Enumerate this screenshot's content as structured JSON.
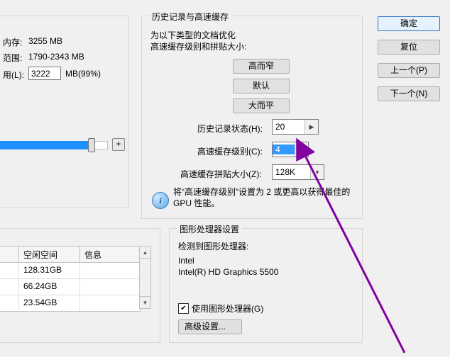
{
  "memory": {
    "label": "内存:",
    "value": "3255 MB",
    "rangeLabel": "范围:",
    "rangeValue": "1790-2343 MB",
    "usedLabel": "用(L):",
    "usedInput": "3222",
    "usedSuffix": "MB(99%)"
  },
  "history": {
    "title": "历史记录与高速缓存",
    "optLabel1": "为以下类型的文档优化",
    "optLabel2": "高速缓存级别和拼贴大小:",
    "btnTall": "高而窄",
    "btnDefault": "默认",
    "btnWide": "大而平",
    "histStatesLabel": "历史记录状态(H):",
    "histStates": "20",
    "cacheLevelLabel": "高速缓存级别(C):",
    "cacheLevel": "4",
    "tileLabel": "高速缓存拼贴大小(Z):",
    "tile": "128K",
    "tip": "将“高速缓存级别”设置为 2 或更高以获得最佳的 GPU 性能。"
  },
  "gpu": {
    "title": "图形处理器设置",
    "detectedLabel": "检测到图形处理器:",
    "vendor": "Intel",
    "model": "Intel(R) HD Graphics 5500",
    "useGpu": "使用图形处理器(G)",
    "advanced": "高级设置..."
  },
  "disks": {
    "colFree": "空闲空间",
    "colInfo": "信息",
    "rows": [
      "128.31GB",
      "66.24GB",
      "23.54GB"
    ]
  },
  "buttons": {
    "ok": "确定",
    "reset": "复位",
    "prev": "上一个(P)",
    "next": "下一个(N)"
  }
}
